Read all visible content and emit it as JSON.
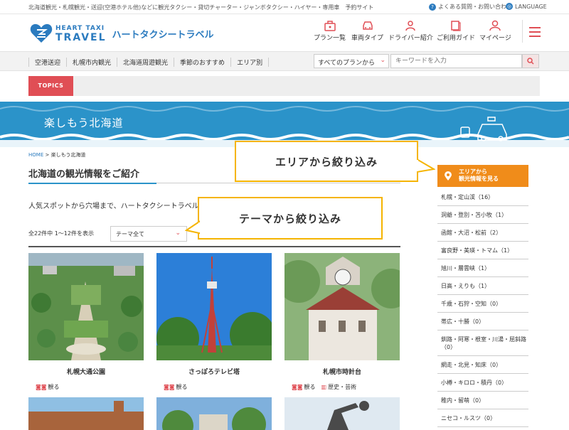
{
  "topbar": {
    "description": "北海道観光・札幌観光・送迎(空港ホテル他)などに観光タクシー・貸切チャーター・ジャンボタクシー・ハイヤー・専用車　予約サイト",
    "faq": "よくある質問・お問い合わせ",
    "language": "LANGUAGE"
  },
  "header": {
    "logo_line1": "HEART TAXI",
    "logo_line2": "TRAVEL",
    "logo_jp": "ハートタクシートラベル",
    "nav": [
      "プラン一覧",
      "車両タイプ",
      "ドライバー紹介",
      "ご利用ガイド",
      "マイページ"
    ]
  },
  "subnav": {
    "links": [
      "空港送迎",
      "札幌市内観光",
      "北海道周遊観光",
      "季節のおすすめ",
      "エリア別"
    ],
    "plan_select": "すべてのプランから",
    "search_placeholder": "キーワードを入力"
  },
  "topics": {
    "label": "TOPICS"
  },
  "banner": {
    "title": "楽しもう北海道"
  },
  "breadcrumb": {
    "home": "HOME",
    "sep": ">",
    "current": "楽しもう北海道"
  },
  "main": {
    "heading": "北海道の観光情報をご紹介",
    "intro": "人気スポットから穴場まで、ハートタクシートラベルお",
    "count": "全22件中 1～12件を表示",
    "theme_select": "テーマ全て"
  },
  "cards": [
    {
      "name": "札幌大通公園",
      "tags": [
        "観る"
      ]
    },
    {
      "name": "さっぽろテレビ塔",
      "tags": [
        "観る"
      ]
    },
    {
      "name": "札幌市時計台",
      "tags": [
        "観る",
        "歴史・芸術"
      ]
    }
  ],
  "sidebar": {
    "heading_line1": "エリアから",
    "heading_line2": "観光情報を見る",
    "areas": [
      "札幌・定山渓（16）",
      "洞爺・登別・苫小牧（1）",
      "函館・大沼・松前（2）",
      "富良野・美瑛・トマム（1）",
      "旭川・層雲峡（1）",
      "日高・えりも（1）",
      "千歳・石狩・空知（0）",
      "帯広・十勝（0）",
      "釧路・阿寒・根室・川湯・屈斜路（0）",
      "網走・北見・知床（0）",
      "小樽・キロロ・積丹（0）",
      "稚内・留萌（0）",
      "ニセコ・ルスツ（0）"
    ]
  },
  "callouts": {
    "area": "エリアから絞り込み",
    "theme": "テーマから絞り込み"
  },
  "colors": {
    "brand_blue": "#2b7bbf",
    "accent_red": "#e04e55",
    "orange": "#f08c1a",
    "callout_border": "#f5b400"
  }
}
